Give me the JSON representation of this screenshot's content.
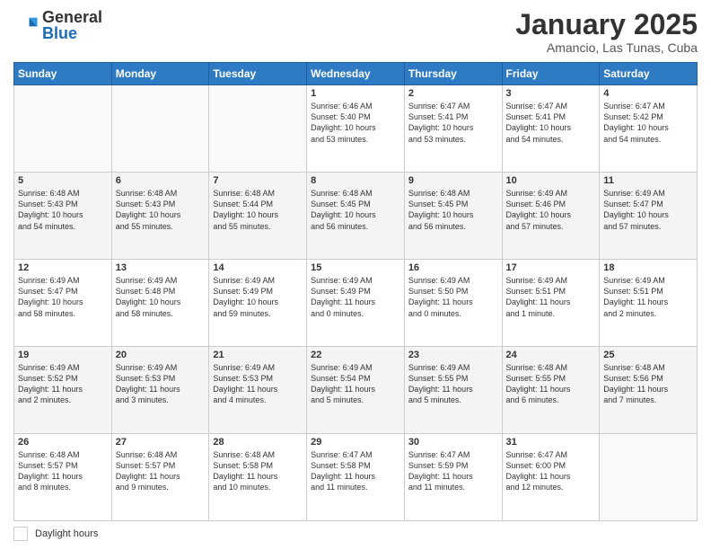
{
  "header": {
    "logo_general": "General",
    "logo_blue": "Blue",
    "month_title": "January 2025",
    "subtitle": "Amancio, Las Tunas, Cuba"
  },
  "days_of_week": [
    "Sunday",
    "Monday",
    "Tuesday",
    "Wednesday",
    "Thursday",
    "Friday",
    "Saturday"
  ],
  "weeks": [
    [
      {
        "day": "",
        "info": ""
      },
      {
        "day": "",
        "info": ""
      },
      {
        "day": "",
        "info": ""
      },
      {
        "day": "1",
        "info": "Sunrise: 6:46 AM\nSunset: 5:40 PM\nDaylight: 10 hours\nand 53 minutes."
      },
      {
        "day": "2",
        "info": "Sunrise: 6:47 AM\nSunset: 5:41 PM\nDaylight: 10 hours\nand 53 minutes."
      },
      {
        "day": "3",
        "info": "Sunrise: 6:47 AM\nSunset: 5:41 PM\nDaylight: 10 hours\nand 54 minutes."
      },
      {
        "day": "4",
        "info": "Sunrise: 6:47 AM\nSunset: 5:42 PM\nDaylight: 10 hours\nand 54 minutes."
      }
    ],
    [
      {
        "day": "5",
        "info": "Sunrise: 6:48 AM\nSunset: 5:43 PM\nDaylight: 10 hours\nand 54 minutes."
      },
      {
        "day": "6",
        "info": "Sunrise: 6:48 AM\nSunset: 5:43 PM\nDaylight: 10 hours\nand 55 minutes."
      },
      {
        "day": "7",
        "info": "Sunrise: 6:48 AM\nSunset: 5:44 PM\nDaylight: 10 hours\nand 55 minutes."
      },
      {
        "day": "8",
        "info": "Sunrise: 6:48 AM\nSunset: 5:45 PM\nDaylight: 10 hours\nand 56 minutes."
      },
      {
        "day": "9",
        "info": "Sunrise: 6:48 AM\nSunset: 5:45 PM\nDaylight: 10 hours\nand 56 minutes."
      },
      {
        "day": "10",
        "info": "Sunrise: 6:49 AM\nSunset: 5:46 PM\nDaylight: 10 hours\nand 57 minutes."
      },
      {
        "day": "11",
        "info": "Sunrise: 6:49 AM\nSunset: 5:47 PM\nDaylight: 10 hours\nand 57 minutes."
      }
    ],
    [
      {
        "day": "12",
        "info": "Sunrise: 6:49 AM\nSunset: 5:47 PM\nDaylight: 10 hours\nand 58 minutes."
      },
      {
        "day": "13",
        "info": "Sunrise: 6:49 AM\nSunset: 5:48 PM\nDaylight: 10 hours\nand 58 minutes."
      },
      {
        "day": "14",
        "info": "Sunrise: 6:49 AM\nSunset: 5:49 PM\nDaylight: 10 hours\nand 59 minutes."
      },
      {
        "day": "15",
        "info": "Sunrise: 6:49 AM\nSunset: 5:49 PM\nDaylight: 11 hours\nand 0 minutes."
      },
      {
        "day": "16",
        "info": "Sunrise: 6:49 AM\nSunset: 5:50 PM\nDaylight: 11 hours\nand 0 minutes."
      },
      {
        "day": "17",
        "info": "Sunrise: 6:49 AM\nSunset: 5:51 PM\nDaylight: 11 hours\nand 1 minute."
      },
      {
        "day": "18",
        "info": "Sunrise: 6:49 AM\nSunset: 5:51 PM\nDaylight: 11 hours\nand 2 minutes."
      }
    ],
    [
      {
        "day": "19",
        "info": "Sunrise: 6:49 AM\nSunset: 5:52 PM\nDaylight: 11 hours\nand 2 minutes."
      },
      {
        "day": "20",
        "info": "Sunrise: 6:49 AM\nSunset: 5:53 PM\nDaylight: 11 hours\nand 3 minutes."
      },
      {
        "day": "21",
        "info": "Sunrise: 6:49 AM\nSunset: 5:53 PM\nDaylight: 11 hours\nand 4 minutes."
      },
      {
        "day": "22",
        "info": "Sunrise: 6:49 AM\nSunset: 5:54 PM\nDaylight: 11 hours\nand 5 minutes."
      },
      {
        "day": "23",
        "info": "Sunrise: 6:49 AM\nSunset: 5:55 PM\nDaylight: 11 hours\nand 5 minutes."
      },
      {
        "day": "24",
        "info": "Sunrise: 6:48 AM\nSunset: 5:55 PM\nDaylight: 11 hours\nand 6 minutes."
      },
      {
        "day": "25",
        "info": "Sunrise: 6:48 AM\nSunset: 5:56 PM\nDaylight: 11 hours\nand 7 minutes."
      }
    ],
    [
      {
        "day": "26",
        "info": "Sunrise: 6:48 AM\nSunset: 5:57 PM\nDaylight: 11 hours\nand 8 minutes."
      },
      {
        "day": "27",
        "info": "Sunrise: 6:48 AM\nSunset: 5:57 PM\nDaylight: 11 hours\nand 9 minutes."
      },
      {
        "day": "28",
        "info": "Sunrise: 6:48 AM\nSunset: 5:58 PM\nDaylight: 11 hours\nand 10 minutes."
      },
      {
        "day": "29",
        "info": "Sunrise: 6:47 AM\nSunset: 5:58 PM\nDaylight: 11 hours\nand 11 minutes."
      },
      {
        "day": "30",
        "info": "Sunrise: 6:47 AM\nSunset: 5:59 PM\nDaylight: 11 hours\nand 11 minutes."
      },
      {
        "day": "31",
        "info": "Sunrise: 6:47 AM\nSunset: 6:00 PM\nDaylight: 11 hours\nand 12 minutes."
      },
      {
        "day": "",
        "info": ""
      }
    ]
  ],
  "footer": {
    "daylight_label": "Daylight hours"
  }
}
